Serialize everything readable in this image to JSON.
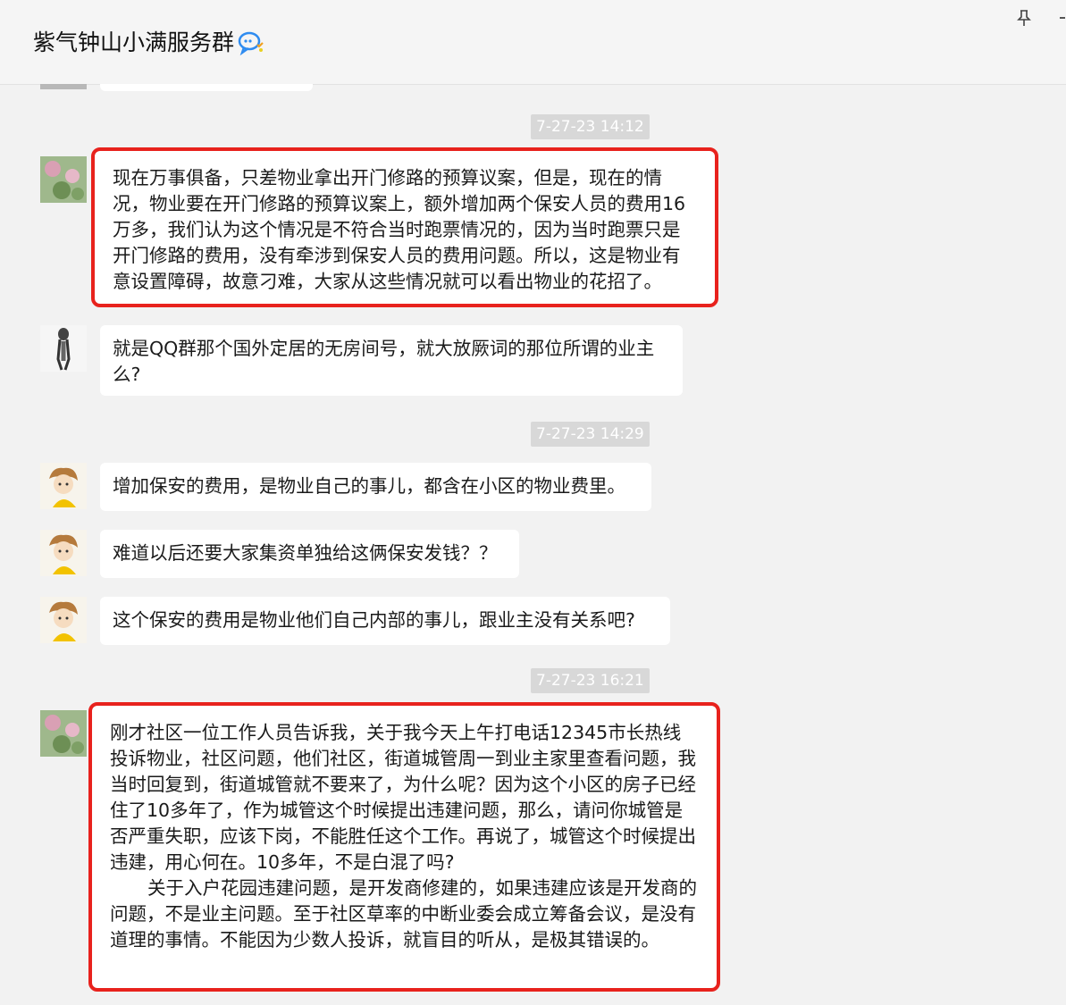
{
  "header": {
    "title": "紫气钟山小满服务群"
  },
  "colors": {
    "background": "#f2f2f2",
    "bubble": "#ffffff",
    "highlight": "#e8221d",
    "timestamp_bg": "#d8d8d8",
    "timestamp_text": "#ffffff"
  },
  "messages": {
    "t1": "7-27-23 14:12",
    "m1": "现在万事俱备，只差物业拿出开门修路的预算议案，但是，现在的情况，物业要在开门修路的预算议案上，额外增加两个保安人员的费用16万多，我们认为这个情况是不符合当时跑票情况的，因为当时跑票只是开门修路的费用，没有牵涉到保安人员的费用问题。所以，这是物业有意设置障碍，故意刁难，大家从这些情况就可以看出物业的花招了。",
    "m2": "就是QQ群那个国外定居的无房间号，就大放厥词的那位所谓的业主么?",
    "t2": "7-27-23 14:29",
    "m3": "增加保安的费用，是物业自己的事儿，都含在小区的物业费里。",
    "m4": "难道以后还要大家集资单独给这俩保安发钱？？",
    "m5": "这个保安的费用是物业他们自己内部的事儿，跟业主没有关系吧?",
    "t3": "7-27-23 16:21",
    "m6_p1": "刚才社区一位工作人员告诉我，关于我今天上午打电话12345市长热线投诉物业，社区问题，他们社区，街道城管周一到业主家里查看问题，我当时回复到，街道城管就不要来了，为什么呢？因为这个小区的房子已经住了10多年了，作为城管这个时候提出违建问题，那么，请问你城管是否严重失职，应该下岗，不能胜任这个工作。再说了，城管这个时候提出违建，用心何在。10多年，不是白混了吗?",
    "m6_p2": "关于入户花园违建问题，是开发商修建的，如果违建应该是开发商的问题，不是业主问题。至于社区草率的中断业委会成立筹备会议，是没有道理的事情。不能因为少数人投诉，就盲目的听从，是极其错误的。"
  }
}
